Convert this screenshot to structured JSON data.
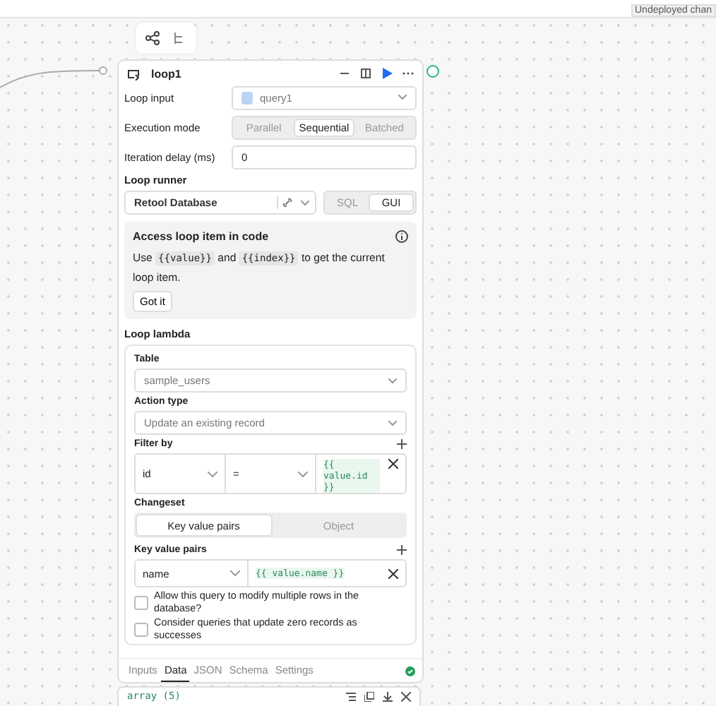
{
  "top_bar": {
    "status": "Undeployed chan"
  },
  "node": {
    "title": "loop1",
    "fields": [
      {
        "kind": "select",
        "label": "Loop input",
        "value": "query1"
      },
      {
        "kind": "segmented",
        "label": "Execution mode",
        "options": [
          {
            "label": "Parallel",
            "selected": false
          },
          {
            "label": "Sequential",
            "selected": true
          },
          {
            "label": "Batched",
            "selected": false
          }
        ]
      },
      {
        "kind": "input",
        "label": "Iteration delay (ms)",
        "value": "0"
      }
    ],
    "loop_runner": {
      "label": "Loop runner",
      "resource": "Retool Database",
      "modes": [
        {
          "label": "SQL",
          "selected": false
        },
        {
          "label": "GUI",
          "selected": true
        }
      ]
    },
    "info": {
      "title": "Access loop item in code",
      "parts": [
        {
          "kind": "text",
          "text": "Use"
        },
        {
          "kind": "code",
          "text": "{{value}}"
        },
        {
          "kind": "text",
          "text": "and"
        },
        {
          "kind": "code",
          "text": "{{index}}"
        },
        {
          "kind": "text",
          "text": "to get the current loop item."
        }
      ],
      "button": "Got it"
    },
    "lambda": {
      "label": "Loop lambda",
      "table_label": "Table",
      "table": "sample_users",
      "action_label": "Action type",
      "action": "Update an existing record",
      "filter_label": "Filter by",
      "filter": {
        "column": "id",
        "operator": "=",
        "value": "{{ value.id }}"
      },
      "changeset_label": "Changeset",
      "changeset_modes": [
        {
          "label": "Key value pairs",
          "selected": true
        },
        {
          "label": "Object",
          "selected": false
        }
      ],
      "kv_label": "Key value pairs",
      "kv": {
        "key": "name",
        "value": "{{ value.name }}"
      },
      "options": [
        {
          "label": "Allow this query to modify multiple rows in the database?",
          "checked": false
        },
        {
          "label": "Consider queries that update zero records as successes",
          "checked": false
        }
      ]
    },
    "tabs": [
      {
        "label": "Inputs",
        "selected": false
      },
      {
        "label": "Data",
        "selected": true
      },
      {
        "label": "JSON",
        "selected": false
      },
      {
        "label": "Schema",
        "selected": false
      },
      {
        "label": "Settings",
        "selected": false
      }
    ]
  },
  "output": {
    "type": "array (5)"
  }
}
